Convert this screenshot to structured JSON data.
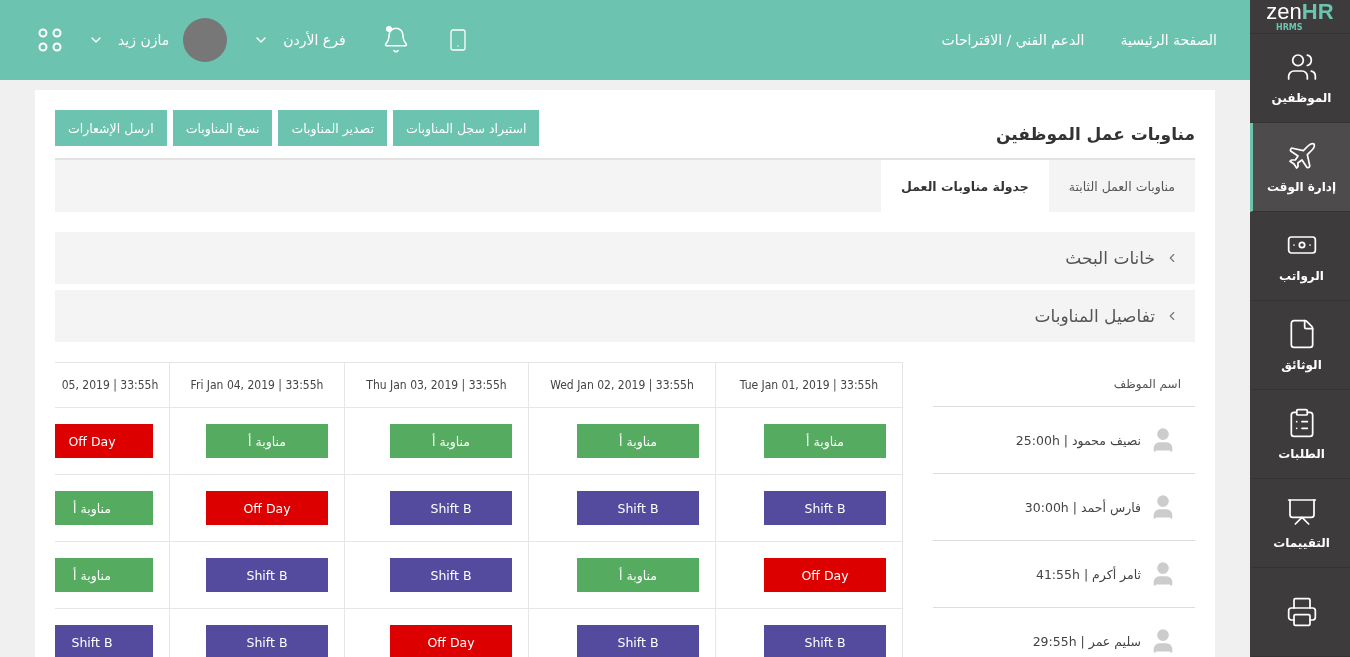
{
  "logo": {
    "main": "zen",
    "accent": "HR",
    "sub": "HRMS"
  },
  "sidebar": {
    "items": [
      {
        "label": "الموظفين",
        "selected": false
      },
      {
        "label": "إدارة الوقت",
        "selected": true
      },
      {
        "label": "الرواتب",
        "selected": false
      },
      {
        "label": "الوثائق",
        "selected": false
      },
      {
        "label": "الطلبات",
        "selected": false
      },
      {
        "label": "التقييمات",
        "selected": false
      }
    ]
  },
  "header": {
    "nav": [
      "الصفحة الرئيسية",
      "الدعم الفني / الاقتراحات"
    ],
    "notifications": true,
    "branch": "فرع الأردن",
    "user": "مازن زيد"
  },
  "page": {
    "title": "مناوبات عمل الموظفين",
    "actions": [
      "استيراد سجل المناوبات",
      "تصدير المناوبات",
      "نسخ المناوبات",
      "ارسل الإشعارات"
    ]
  },
  "tabs": [
    {
      "label": "مناوبات العمل الثابتة",
      "selected": false
    },
    {
      "label": "جدولة مناوبات العمل",
      "selected": true
    }
  ],
  "sections": [
    {
      "title": "خانات البحث",
      "expanded": false
    },
    {
      "title": "تفاصيل المناوبات",
      "expanded": false
    }
  ],
  "schedule": {
    "employee_header": "اسم الموظف",
    "days": [
      "Tue Jan 01, 2019 | 33:55h",
      "Wed Jan 02, 2019 | 33:55h",
      "Thu Jan 03, 2019 | 33:55h",
      "Fri Jan 04, 2019 | 33:55h",
      "05, 2019 | 33:55h"
    ],
    "rows": [
      {
        "employee": "نصيف محمود | 25:00h",
        "shifts": [
          {
            "kind": "a",
            "label": "مناوبة أ"
          },
          {
            "kind": "a",
            "label": "مناوبة أ"
          },
          {
            "kind": "a",
            "label": "مناوبة أ"
          },
          {
            "kind": "a",
            "label": "مناوبة أ"
          },
          {
            "kind": "off",
            "label": "Off Day"
          }
        ]
      },
      {
        "employee": "فارس أحمد | 30:00h",
        "shifts": [
          {
            "kind": "b",
            "label": "Shift B"
          },
          {
            "kind": "b",
            "label": "Shift B"
          },
          {
            "kind": "b",
            "label": "Shift B"
          },
          {
            "kind": "off",
            "label": "Off Day"
          },
          {
            "kind": "a",
            "label": "مناوبة أ"
          }
        ]
      },
      {
        "employee": "ثامر أكرم | 41:55h",
        "shifts": [
          {
            "kind": "off",
            "label": "Off Day"
          },
          {
            "kind": "a",
            "label": "مناوبة أ"
          },
          {
            "kind": "b",
            "label": "Shift B"
          },
          {
            "kind": "b",
            "label": "Shift B"
          },
          {
            "kind": "a",
            "label": "مناوبة أ"
          }
        ]
      },
      {
        "employee": "سليم عمر | 29:55h",
        "shifts": [
          {
            "kind": "b",
            "label": "Shift B"
          },
          {
            "kind": "b",
            "label": "Shift B"
          },
          {
            "kind": "off",
            "label": "Off Day"
          },
          {
            "kind": "b",
            "label": "Shift B"
          },
          {
            "kind": "b",
            "label": "Shift B"
          }
        ]
      }
    ]
  }
}
